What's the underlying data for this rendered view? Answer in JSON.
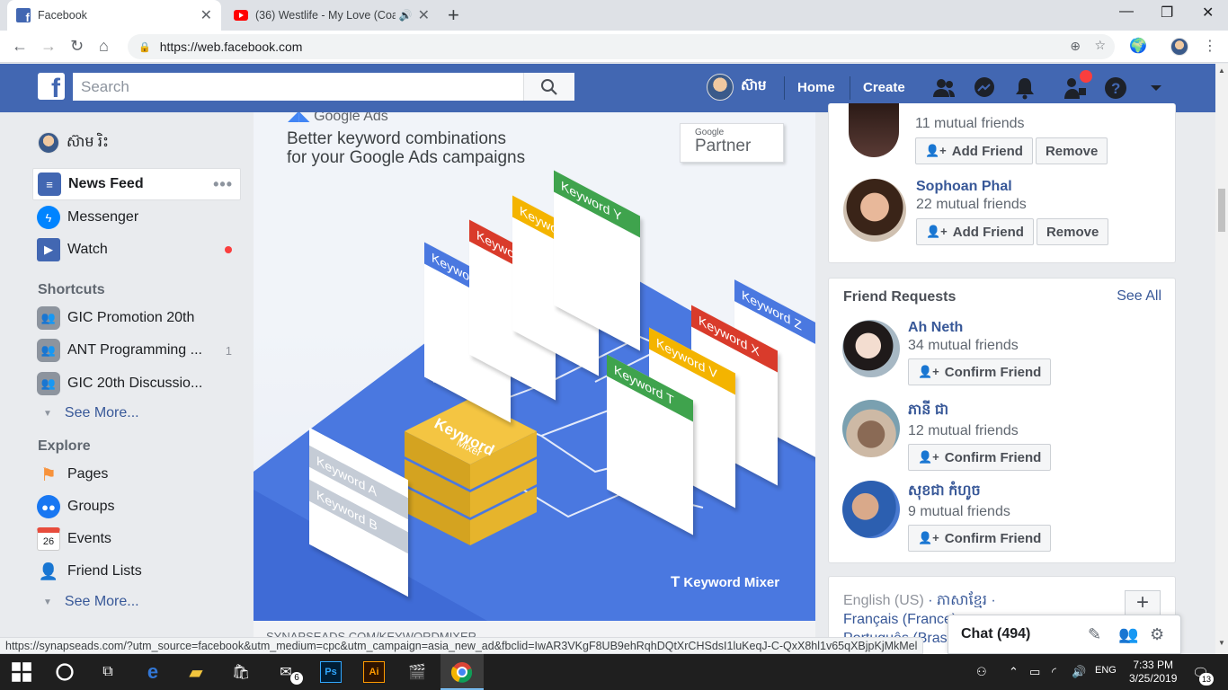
{
  "browser": {
    "tabs": [
      {
        "title": "Facebook",
        "active": true
      },
      {
        "title": "(36) Westlife - My Love (Coa",
        "active": false
      }
    ],
    "url": "https://web.facebook.com"
  },
  "fb_header": {
    "search_placeholder": "Search",
    "user_name": "ស៊ាម",
    "nav": {
      "home": "Home",
      "create": "Create"
    }
  },
  "left_nav": {
    "profile_name": "ស៊ាម រិះ",
    "items": [
      {
        "label": "News Feed",
        "icon": "news-feed-icon"
      },
      {
        "label": "Messenger",
        "icon": "messenger-icon"
      },
      {
        "label": "Watch",
        "icon": "watch-icon"
      }
    ],
    "shortcuts_heading": "Shortcuts",
    "shortcuts": [
      {
        "label": "GIC Promotion 20th",
        "count": ""
      },
      {
        "label": "ANT Programming ...",
        "count": "1"
      },
      {
        "label": "GIC 20th Discussio...",
        "count": ""
      }
    ],
    "see_more": "See More...",
    "explore_heading": "Explore",
    "explore": [
      {
        "label": "Pages",
        "icon": "flag-icon"
      },
      {
        "label": "Groups",
        "icon": "groups-icon"
      },
      {
        "label": "Events",
        "icon": "calendar-icon",
        "day": "26"
      },
      {
        "label": "Friend Lists",
        "icon": "friend-lists-icon"
      }
    ]
  },
  "ad": {
    "brand": "Google Ads",
    "headline_line1": "Better keyword combinations",
    "headline_line2": "for your Google Ads campaigns",
    "partner_top": "Google",
    "partner_bottom": "Partner",
    "watermark": "Keyword Mixer",
    "caption": "SYNAPSEADS.COM/KEYWORDMIXER",
    "tiles": [
      "Keyword S",
      "Keyword U",
      "Keyword W",
      "Keyword Y",
      "Keyword Z",
      "Keyword X",
      "Keyword V",
      "Keyword T",
      "Keyword A",
      "Keyword B"
    ],
    "mixer_label": "Keyword Mixer"
  },
  "people_you_may_know": [
    {
      "name": "",
      "mutual": "11 mutual friends"
    },
    {
      "name": "Sophoan Phal",
      "mutual": "22 mutual friends"
    }
  ],
  "friend_requests": {
    "title": "Friend Requests",
    "see_all": "See All",
    "items": [
      {
        "name": "Ah Neth",
        "mutual": "34 mutual friends"
      },
      {
        "name": "ភានី ជា",
        "mutual": "12 mutual friends"
      },
      {
        "name": "សុខជា កំហូច",
        "mutual": "9 mutual friends"
      }
    ]
  },
  "buttons": {
    "add_friend": "Add Friend",
    "remove": "Remove",
    "confirm_friend": "Confirm Friend"
  },
  "languages": {
    "current": "English (US)",
    "other1": "ភាសាខ្មែរ",
    "other2": "Français (France)",
    "other3": "Português (Brasil)"
  },
  "chat": {
    "label": "Chat (494)"
  },
  "status_url": "https://synapseads.com/?utm_source=facebook&utm_medium=cpc&utm_campaign=asia_new_ad&fbclid=IwAR3VKgF8UB9ehRqhDQtXrCHSdsI1luKeqJ-C-QxX8hl1v65qXBjpKjMkMel",
  "taskbar": {
    "mail_badge": "6",
    "lang": "ENG",
    "time": "7:33 PM",
    "date": "3/25/2019",
    "notif_count": "13"
  },
  "colors": {
    "fb_blue": "#4267b2",
    "link": "#385898",
    "red_dot": "#fa3e3e"
  }
}
